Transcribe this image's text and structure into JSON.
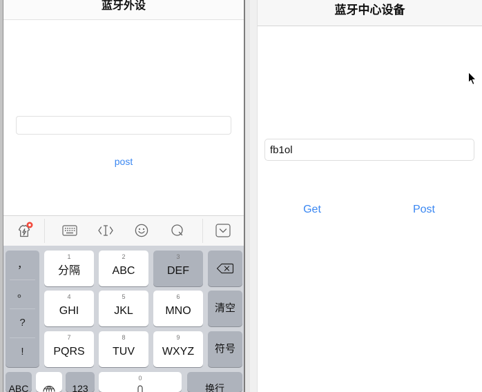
{
  "left_panel": {
    "title": "蓝牙外设",
    "text_field_value": "",
    "post_button_label": "post"
  },
  "keyboard_toolbar": {
    "icons": [
      "app-badge-icon",
      "keyboard-icon",
      "cursor-move-icon",
      "emoji-icon",
      "search-icon",
      "hide-keyboard-icon"
    ]
  },
  "keyboard": {
    "punctuation": [
      "，",
      "。",
      "?",
      "!"
    ],
    "keys": [
      {
        "digit": "1",
        "label": "分隔"
      },
      {
        "digit": "2",
        "label": "ABC"
      },
      {
        "digit": "3",
        "label": "DEF",
        "pressed": true
      },
      {
        "digit": "4",
        "label": "GHI"
      },
      {
        "digit": "5",
        "label": "JKL"
      },
      {
        "digit": "6",
        "label": "MNO"
      },
      {
        "digit": "7",
        "label": "PQRS"
      },
      {
        "digit": "8",
        "label": "TUV"
      },
      {
        "digit": "9",
        "label": "WXYZ"
      }
    ],
    "backspace_icon": "backspace-icon",
    "clear_label": "清空",
    "symbols_label": "符号",
    "abc_label": "ABC",
    "globe_icon": "globe-icon",
    "numbers_label": "123",
    "space_digit": "0",
    "microphone_icon": "microphone-icon",
    "return_label": "换行"
  },
  "right_panel": {
    "title": "蓝牙中心设备",
    "text_field_value": "fb1ol",
    "get_button_label": "Get",
    "post_button_label": "Post"
  },
  "pointer_icon": "mouse-pointer-icon",
  "colors": {
    "accent_blue": "#3a87f2",
    "badge_red": "#f24a3d",
    "keyboard_background": "#d1d4da",
    "dark_key": "#aeb3bc",
    "light_key": "#ffffff"
  }
}
